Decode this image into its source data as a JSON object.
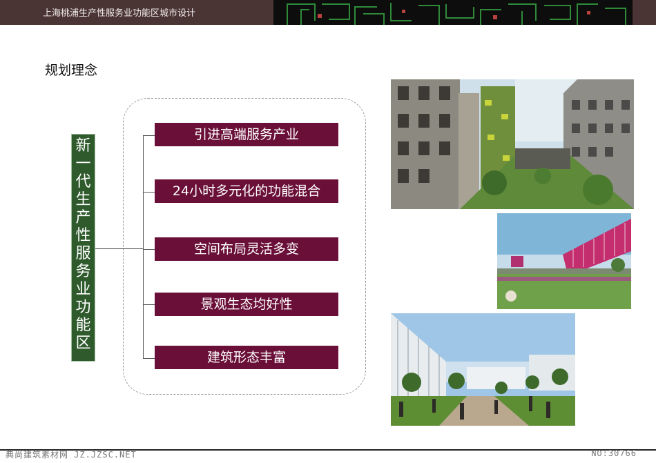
{
  "header": {
    "title": "上海桃浦生产性服务业功能区城市设计"
  },
  "section_heading": "规划理念",
  "center_label": "新一代生产性服务业功能区",
  "concepts": [
    "引进高端服务产业",
    "24小时多元化的功能混合",
    "空间布局灵活多变",
    "景观生态均好性",
    "建筑形态丰富"
  ],
  "footer": {
    "watermark": "典尚建筑素材网 JZ.JZSC.NET",
    "page_no": "NO:30766"
  },
  "colors": {
    "topbar": "#4a3434",
    "concept_box": "#6a0f38",
    "label_box": "#2e5a2c"
  }
}
